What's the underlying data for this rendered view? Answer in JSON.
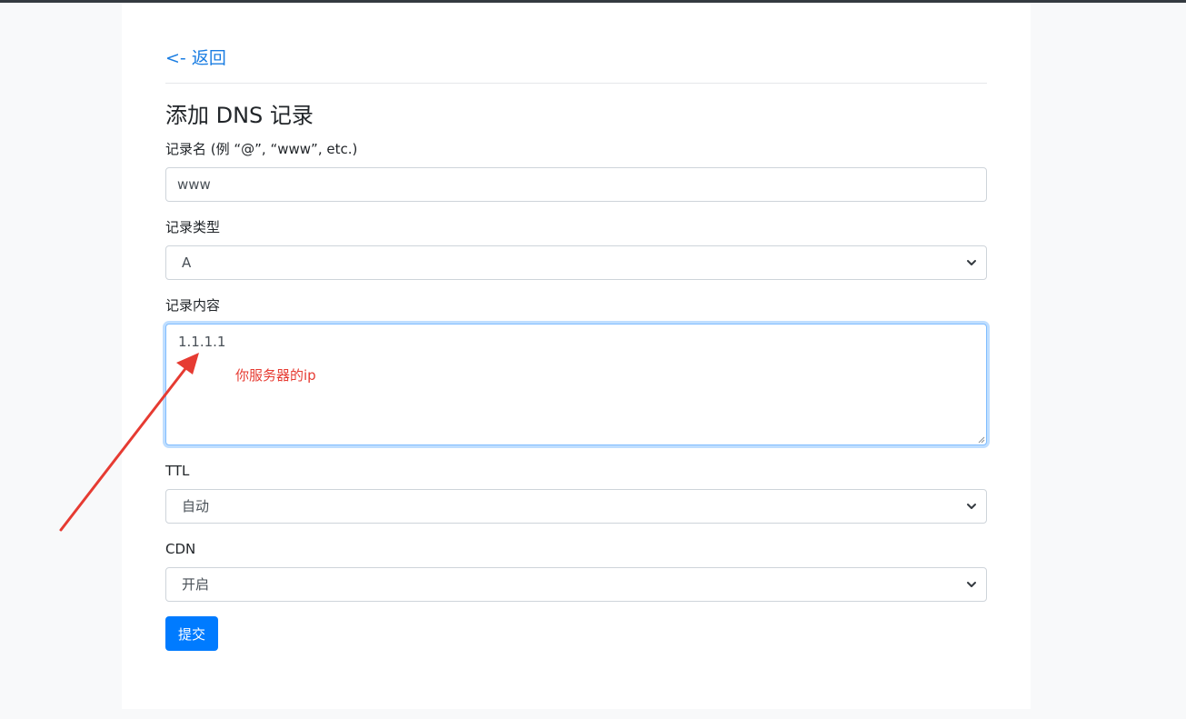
{
  "nav": {
    "back_label": "<- 返回"
  },
  "page": {
    "title": "添加 DNS 记录"
  },
  "form": {
    "record_name": {
      "label": "记录名 (例 “@”, “www”, etc.)",
      "value": "www"
    },
    "record_type": {
      "label": "记录类型",
      "selected": "A"
    },
    "record_content": {
      "label": "记录内容",
      "value": "1.1.1.1"
    },
    "ttl": {
      "label": "TTL",
      "selected": "自动"
    },
    "cdn": {
      "label": "CDN",
      "selected": "开启"
    },
    "submit_label": "提交"
  },
  "annotation": {
    "text": "你服务器的ip",
    "color": "#e63b32"
  },
  "colors": {
    "link": "#1a7de2",
    "primary": "#007bff",
    "focus_border": "#80bdff"
  },
  "icons": {
    "select_arrow": "chevron-down-icon",
    "textarea_corner": "resize-grip-icon",
    "annotation_arrow": "arrow-icon"
  }
}
